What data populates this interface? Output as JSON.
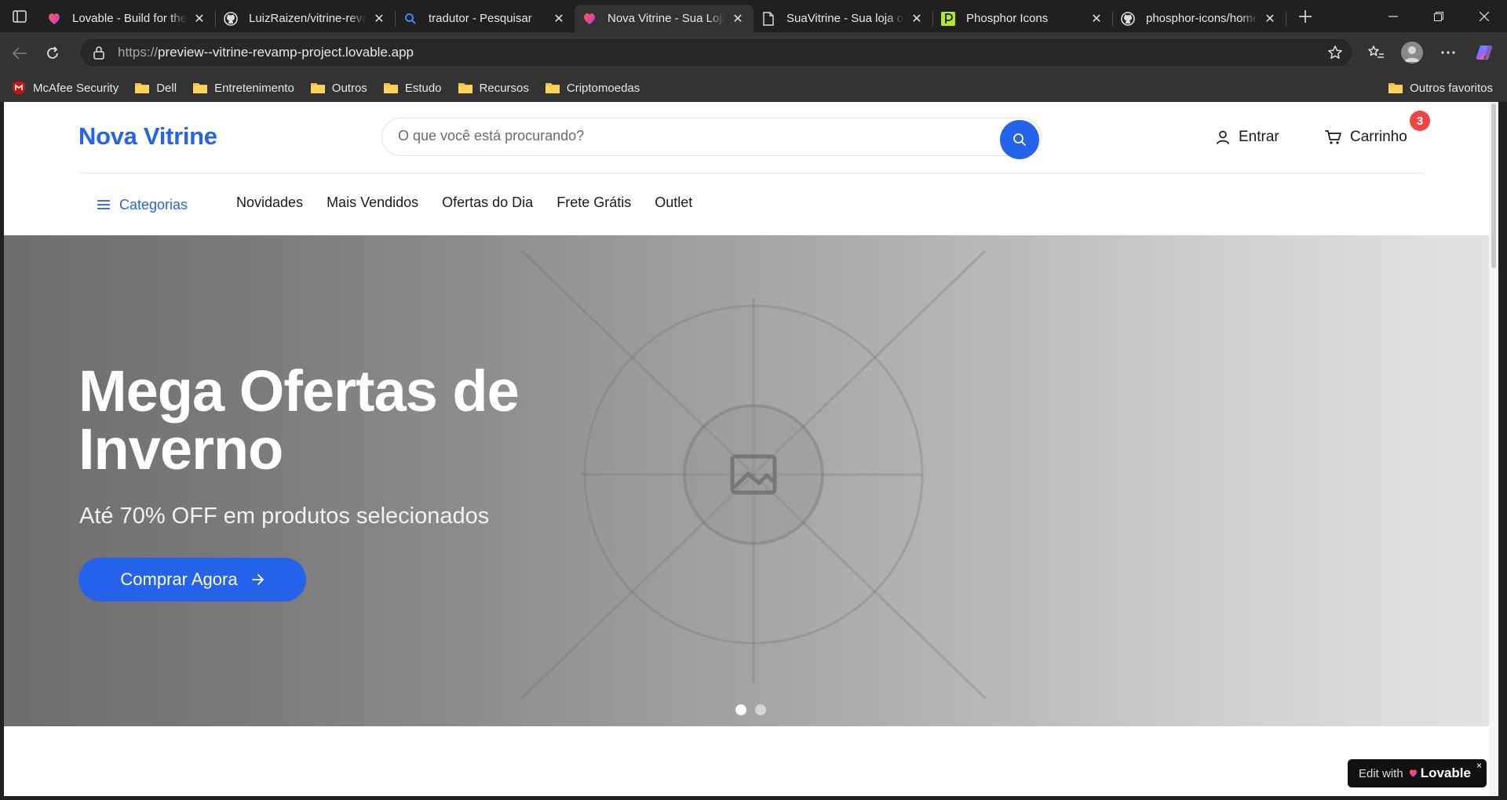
{
  "browser": {
    "tabs": [
      {
        "title": "Lovable - Build for the web",
        "icon": "lovable-heart-icon",
        "active": false
      },
      {
        "title": "LuizRaizen/vitrine-revamp",
        "icon": "github-icon",
        "active": false
      },
      {
        "title": "tradutor - Pesquisar",
        "icon": "search-icon",
        "active": false
      },
      {
        "title": "Nova Vitrine - Sua Loja Online",
        "icon": "lovable-heart-icon",
        "active": true
      },
      {
        "title": "SuaVitrine - Sua loja online",
        "icon": "document-icon",
        "active": false
      },
      {
        "title": "Phosphor Icons",
        "icon": "phosphor-icon",
        "active": false
      },
      {
        "title": "phosphor-icons/homepage",
        "icon": "github-icon",
        "active": false
      }
    ],
    "url_proto": "https://",
    "url_rest": "preview--vitrine-revamp-project.lovable.app",
    "bookmarks": [
      {
        "label": "McAfee Security",
        "icon": "mcafee-icon"
      },
      {
        "label": "Dell",
        "icon": "folder-icon"
      },
      {
        "label": "Entretenimento",
        "icon": "folder-icon"
      },
      {
        "label": "Outros",
        "icon": "folder-icon"
      },
      {
        "label": "Estudo",
        "icon": "folder-icon"
      },
      {
        "label": "Recursos",
        "icon": "folder-icon"
      },
      {
        "label": "Criptomoedas",
        "icon": "folder-icon"
      }
    ],
    "other_favorites": "Outros favoritos"
  },
  "site": {
    "logo": "Nova Vitrine",
    "search_placeholder": "O que você está procurando?",
    "login_label": "Entrar",
    "cart_label": "Carrinho",
    "cart_count": "3",
    "categories_label": "Categorias",
    "nav_links": [
      "Novidades",
      "Mais Vendidos",
      "Ofertas do Dia",
      "Frete Grátis",
      "Outlet"
    ]
  },
  "hero": {
    "title": "Mega Ofertas de Inverno",
    "subtitle": "Até 70% OFF em produtos selecionados",
    "cta": "Comprar Agora",
    "slides_total": 2,
    "active_slide": 1
  },
  "lovable_badge": {
    "prefix": "Edit with",
    "brand": "Lovable",
    "close": "×"
  },
  "colors": {
    "brand_blue": "#2563eb",
    "badge_red": "#ef4444"
  }
}
